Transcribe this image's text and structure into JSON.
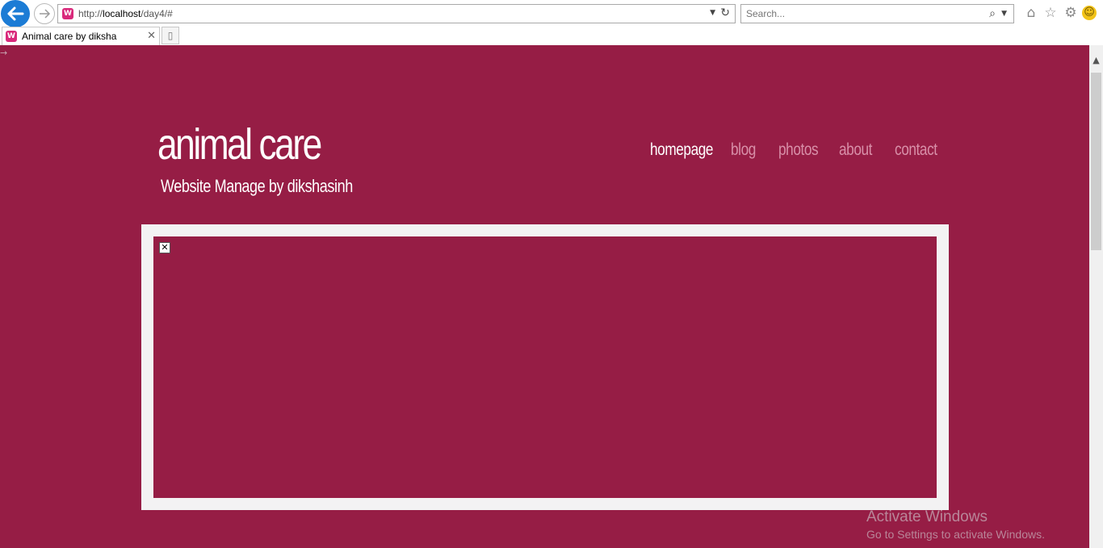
{
  "browser": {
    "url_prefix": "http://",
    "url_host": "localhost",
    "url_path": "/day4/#",
    "search_placeholder": "Search...",
    "tab_title": "Animal care by diksha",
    "icons": {
      "back": "back-arrow-icon",
      "forward": "forward-arrow-icon",
      "home": "home-icon",
      "favorites": "star-icon",
      "tools": "gear-icon",
      "feedback": "smiley-icon"
    }
  },
  "site": {
    "title": "animal care",
    "subtitle": "Website Manage by dikshasinh",
    "nav": [
      {
        "label": "homepage",
        "active": true
      },
      {
        "label": "blog",
        "active": false
      },
      {
        "label": "photos",
        "active": false
      },
      {
        "label": "about",
        "active": false
      },
      {
        "label": "contact",
        "active": false
      }
    ],
    "colors": {
      "background": "#961d45",
      "frame": "#f3f2f3",
      "nav_inactive": "#d88fa8",
      "text": "#ffffff"
    }
  },
  "watermark": {
    "title": "Activate Windows",
    "subtitle": "Go to Settings to activate Windows."
  }
}
